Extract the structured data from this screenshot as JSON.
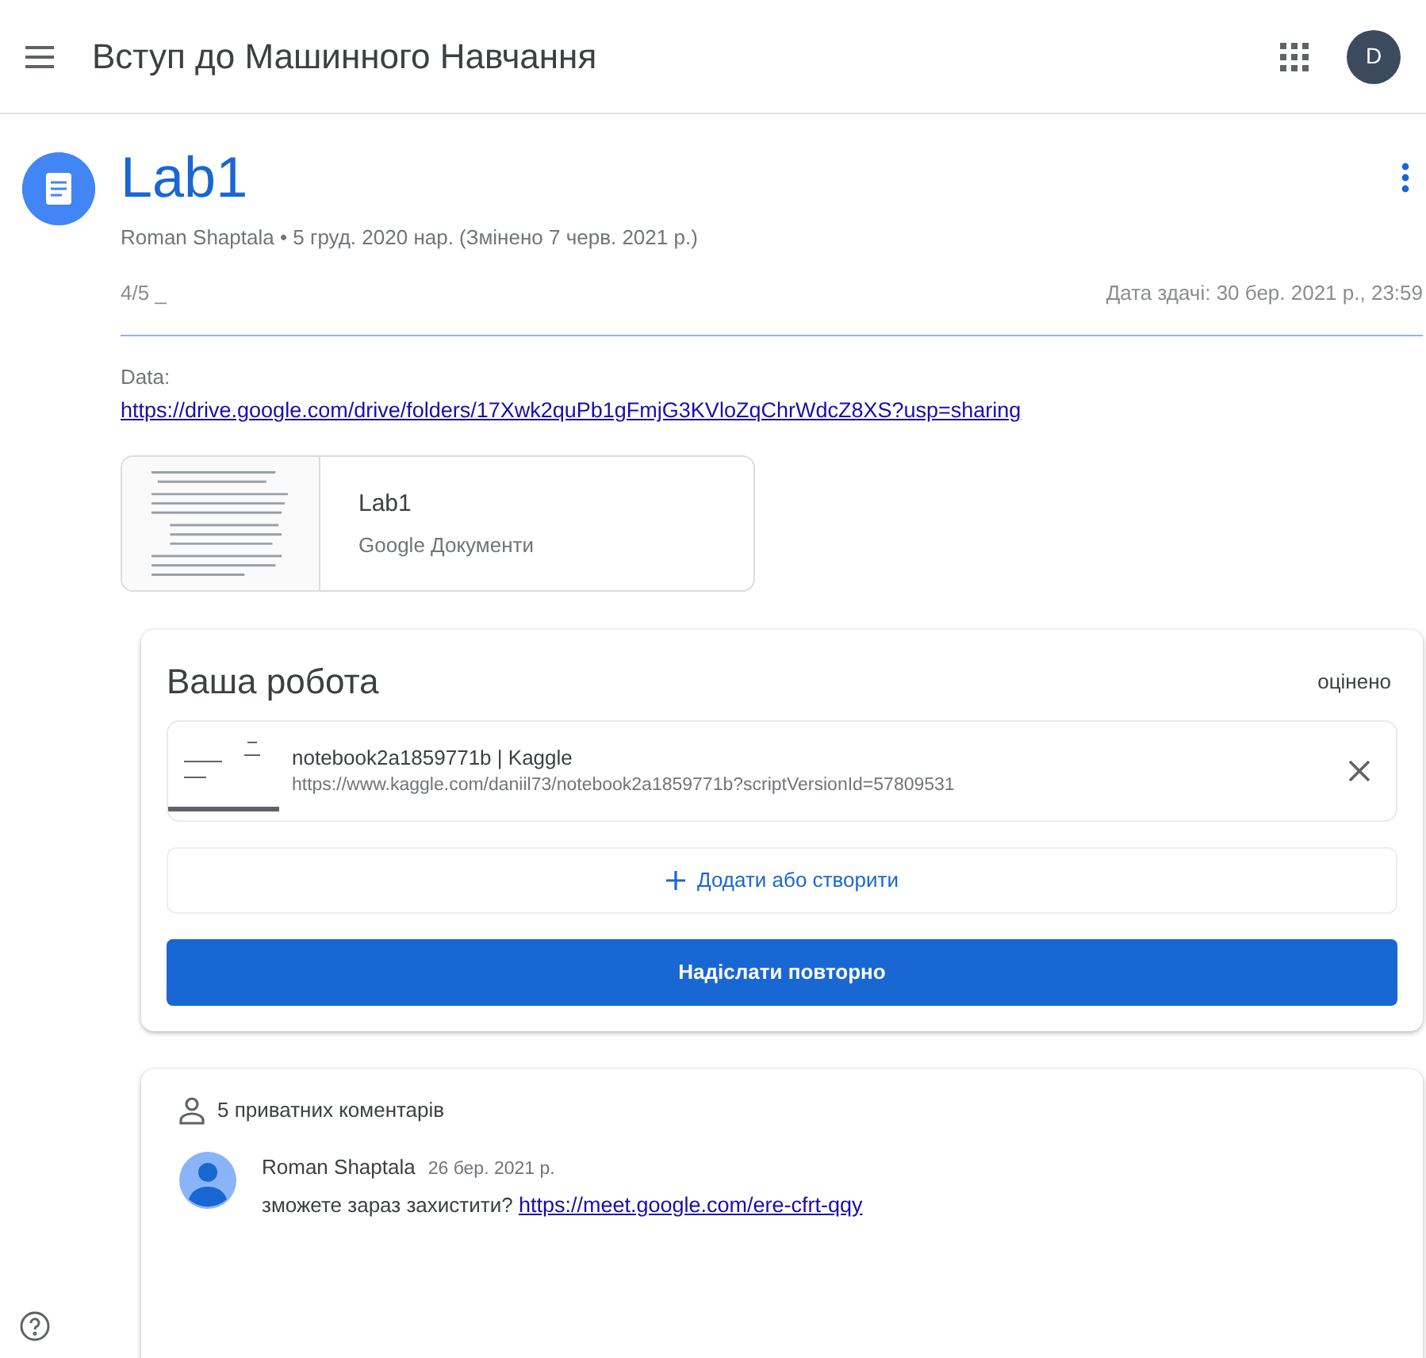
{
  "header": {
    "title": "Вступ до Машинного Навчання",
    "avatar_letter": "D"
  },
  "assignment": {
    "title": "Lab1",
    "meta": "Roman Shaptala • 5 груд. 2020 нар.  (Змінено 7 черв. 2021 р.)",
    "grade": "4/5 _",
    "due": "Дата здачі: 30 бер. 2021 р., 23:59",
    "description_label": "Data:",
    "description_link": "https://drive.google.com/drive/folders/17Xwk2quPb1gFmjG3KVloZqChrWdcZ8XS?usp=sharing"
  },
  "attachment": {
    "title": "Lab1",
    "subtitle": "Google Документи"
  },
  "your_work": {
    "title": "Ваша робота",
    "status": "оцінено",
    "files": [
      {
        "title": "notebook2a1859771b | Kaggle",
        "url": "https://www.kaggle.com/daniil73/notebook2a1859771b?scriptVersionId=57809531"
      }
    ],
    "add_button": "Додати або створити",
    "submit_button": "Надіслати повторно"
  },
  "comments": {
    "count_label": "5 приватних коментарів",
    "items": [
      {
        "author": "Roman Shaptala",
        "date": "26 бер. 2021 р.",
        "text": "зможете зараз захистити?",
        "link": "https://meet.google.com/ere-cfrt-qqy"
      }
    ]
  }
}
